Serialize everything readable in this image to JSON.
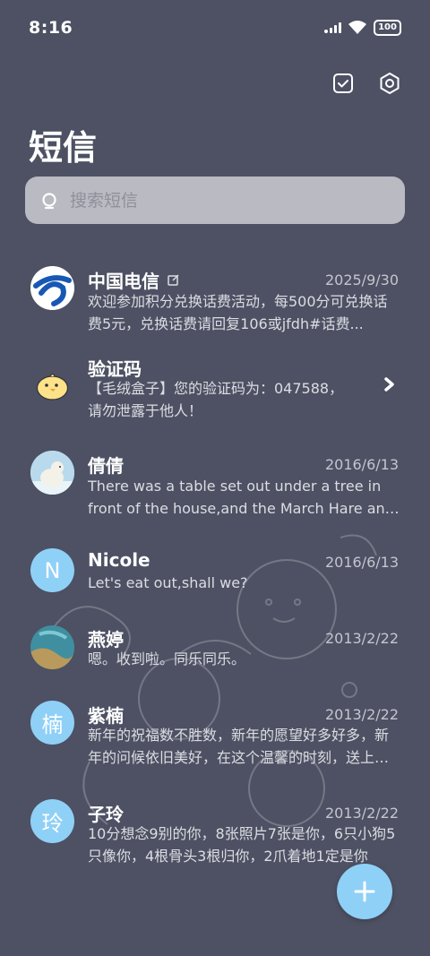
{
  "status_bar": {
    "time": "8:16",
    "battery": "100",
    "icons": [
      "signal-icon",
      "wifi-icon",
      "battery-icon"
    ]
  },
  "header": {
    "title": "短信",
    "actions": [
      {
        "name": "select-messages-icon"
      },
      {
        "name": "settings-icon"
      }
    ]
  },
  "search": {
    "placeholder": "搜索短信"
  },
  "conversations": [
    {
      "name": "中国电信",
      "date": "2025/9/30",
      "preview": "欢迎参加积分兑换话费活动，每500分可兑换话费5元，兑换话费请回复106或jfdh#话费...",
      "avatar": "china-telecom-logo",
      "verified": true
    },
    {
      "name": "验证码",
      "date": "",
      "preview": "【毛绒盒子】您的验证码为：047588，请勿泄露于他人！",
      "avatar": "chick-avatar"
    },
    {
      "name": "倩倩",
      "date": "2016/6/13",
      "preview": "There was a table set out under a tree in front of the house,and the March Hare and the Hatter were having tea at it",
      "avatar": "polar-bear-avatar"
    },
    {
      "name": "Nicole",
      "date": "2016/6/13",
      "preview": "Let's eat out,shall we?",
      "avatar_letter": "N"
    },
    {
      "name": "燕婷",
      "date": "2013/2/22",
      "preview": "嗯。收到啦。同乐同乐。",
      "avatar": "ocean-photo-avatar"
    },
    {
      "name": "紫楠",
      "date": "2013/2/22",
      "preview": "新年的祝福数不胜数，新年的愿望好多好多，新年的问候依旧美好，在这个温馨的时刻，送上我最真挚的祝福",
      "avatar_letter": "楠"
    },
    {
      "name": "子玲",
      "date": "2013/2/22",
      "preview": "10分想念9别的你，8张照片7张是你，6只小狗5只像你，4根骨头3根归你，2爪着地1定是你",
      "avatar_letter": "玲"
    }
  ],
  "fab": {
    "icon": "plus-icon"
  },
  "colors": {
    "background": "#4d5163",
    "accent": "#8fd0f7",
    "search_bg": "#b9bac2"
  }
}
